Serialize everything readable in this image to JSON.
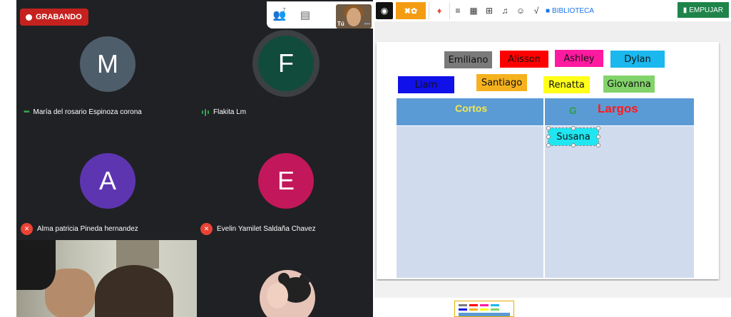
{
  "meeting": {
    "recording_label": "GRABANDO",
    "participant_count": "7",
    "self_label": "Tú",
    "participants": [
      {
        "initial": "M",
        "name": "María del rosario Espinoza corona",
        "color": "#4e5d6a",
        "status": "speaking-dots"
      },
      {
        "initial": "F",
        "name": "Flakita Lm",
        "color": "#114b3c",
        "status": "speaking"
      },
      {
        "initial": "A",
        "name": "Alma patricia Pineda hernandez",
        "color": "#5e35b1",
        "status": "muted"
      },
      {
        "initial": "E",
        "name": "Evelin Yamilet Saldaña Chavez",
        "color": "#c2185b",
        "status": "muted"
      }
    ]
  },
  "whiteboard": {
    "library_label": "BIBLIOTECA",
    "push_label": "EMPUJAR",
    "cards": [
      {
        "text": "Emiliano",
        "bg": "#7a7a7a"
      },
      {
        "text": "Alisson",
        "bg": "#ff0000"
      },
      {
        "text": "Ashley",
        "bg": "#ff1aa0"
      },
      {
        "text": "Dylan",
        "bg": "#1ab8ee"
      },
      {
        "text": "Liam",
        "bg": "#1010e8"
      },
      {
        "text": "Santiago",
        "bg": "#f5b21e"
      },
      {
        "text": "Renatta",
        "bg": "#ffff1a"
      },
      {
        "text": "Giovanna",
        "bg": "#82d36a"
      }
    ],
    "table": {
      "header_left": "Cortos",
      "header_right_icon": "G",
      "header_right": "Largos",
      "placed_card": "Susana"
    }
  }
}
